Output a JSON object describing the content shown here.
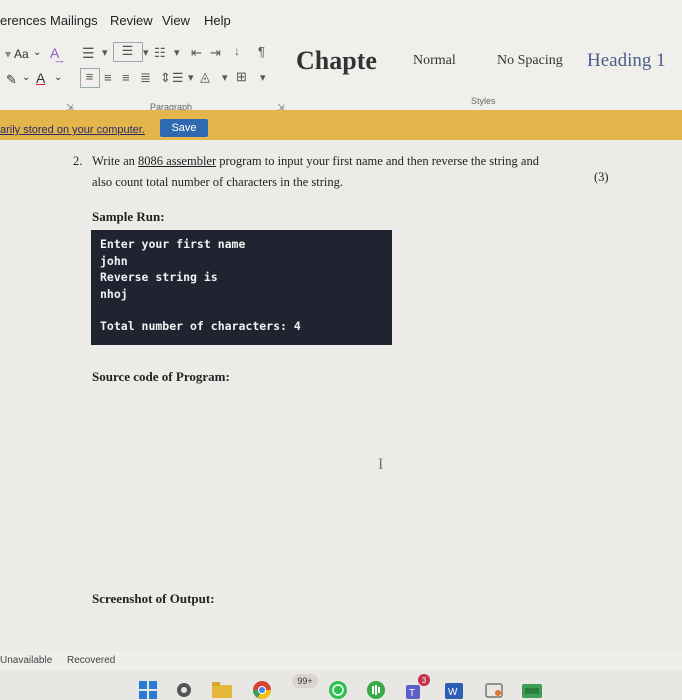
{
  "ribbon": {
    "tabs": [
      "erences",
      "Mailings",
      "Review",
      "View",
      "Help"
    ],
    "font_size_glyph": "Aa",
    "styles": [
      "Chapte",
      "Normal",
      "No Spacing",
      "Heading 1"
    ],
    "group_labels": {
      "paragraph": "Paragraph",
      "styles": "Styles"
    }
  },
  "notification": {
    "text": "arily stored on your computer.",
    "save_label": "Save"
  },
  "document": {
    "question_number": "2.",
    "question_line1_before": "Write an ",
    "question_line1_link": "8086 assembler",
    "question_line1_after": " program to input your first name and then reverse the string and",
    "question_line2": "also count total number of characters in the string.",
    "marks": "(3)",
    "sample_run_title": "Sample Run:",
    "console_lines": [
      "Enter your first name",
      "john",
      "Reverse string is",
      "nhoj",
      "Total number of characters: 4"
    ],
    "source_title": "Source code of Program:",
    "screenshot_title": "Screenshot of Output:"
  },
  "statusbar": {
    "left": "Unavailable",
    "right": "Recovered"
  },
  "taskbar": {
    "badges": {
      "chrome": "99+",
      "teams": "3"
    },
    "icons": [
      "windows-icon",
      "settings-icon",
      "file-explorer-icon",
      "chrome-icon",
      "whatsapp-icon",
      "audio-icon",
      "teams-icon",
      "word-icon",
      "snip-icon",
      "app-icon"
    ]
  },
  "colors": {
    "notification_bar": "#e4b54a",
    "save_button": "#2f69b0",
    "console_bg": "#1f2430",
    "heading1": "#4a5f8a"
  }
}
